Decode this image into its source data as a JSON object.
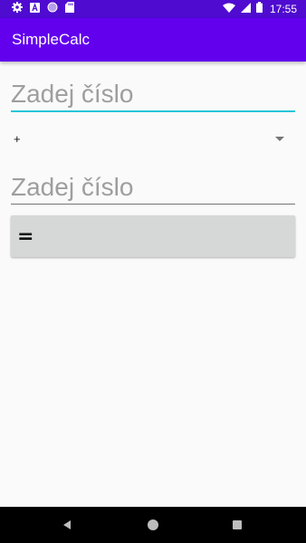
{
  "status_bar": {
    "time": "17:55",
    "left_icons": [
      "gear-icon",
      "a-box-icon",
      "circle-icon",
      "sd-card-icon"
    ],
    "right_icons": [
      "wifi-icon",
      "signal-icon",
      "battery-icon"
    ]
  },
  "app_bar": {
    "title": "SimpleCalc"
  },
  "form": {
    "first_number_placeholder": "Zadej číslo",
    "first_number_value": "",
    "operator_value": "+",
    "second_number_placeholder": "Zadej číslo",
    "second_number_value": "",
    "equals_label": "="
  },
  "navigation": {
    "buttons": [
      "back-icon",
      "home-icon",
      "recents-icon"
    ]
  },
  "colors": {
    "status_bar": "#4f0bd0",
    "app_bar": "#6200ee",
    "accent": "#26c6da",
    "background": "#fafafa",
    "button": "#d6d7d7",
    "nav_bar": "#000000"
  }
}
